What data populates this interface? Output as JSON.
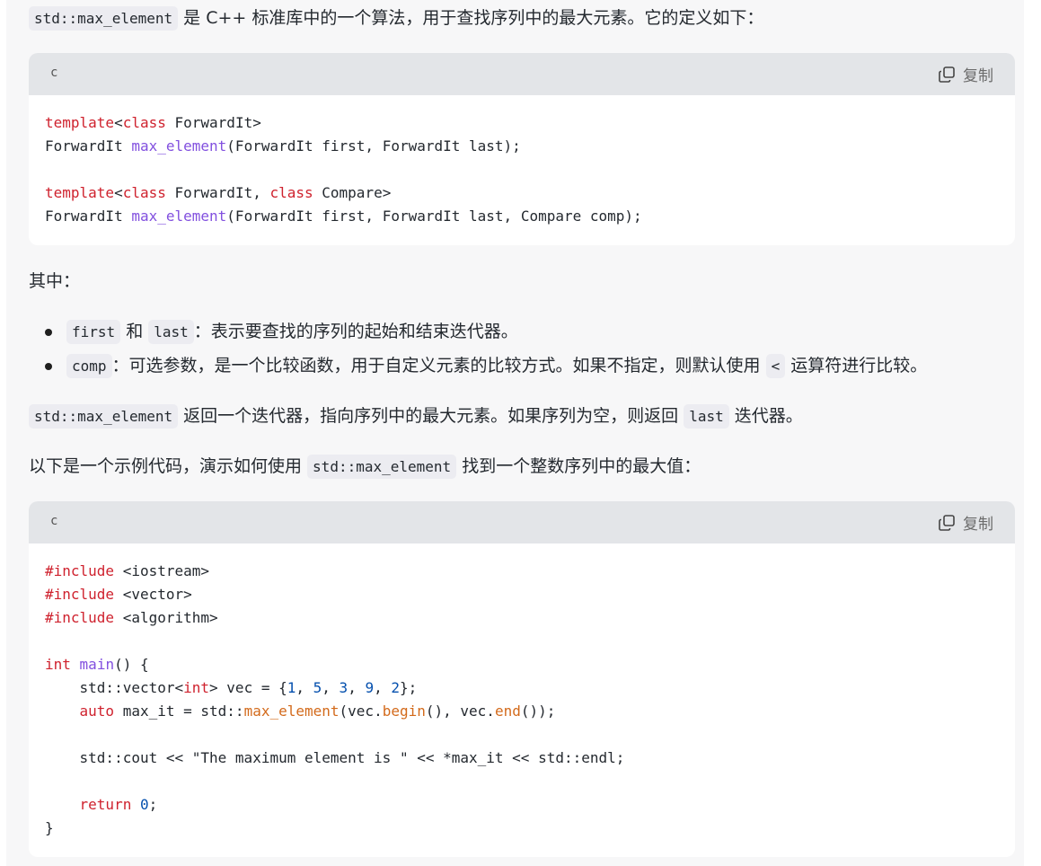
{
  "intro": {
    "code": "std::max_element",
    "text": " 是 C++ 标准库中的一个算法，用于查找序列中的最大元素。它的定义如下："
  },
  "code1": {
    "lang": "c",
    "copy_label": "复制",
    "lines": [
      [
        {
          "t": "template",
          "c": "kw"
        },
        {
          "t": "<"
        },
        {
          "t": "class",
          "c": "kw"
        },
        {
          "t": " ForwardIt>"
        }
      ],
      [
        {
          "t": "ForwardIt "
        },
        {
          "t": "max_element",
          "c": "fn"
        },
        {
          "t": "(ForwardIt first, ForwardIt last);"
        }
      ],
      [
        {
          "t": ""
        }
      ],
      [
        {
          "t": "template",
          "c": "kw"
        },
        {
          "t": "<"
        },
        {
          "t": "class",
          "c": "kw"
        },
        {
          "t": " ForwardIt, "
        },
        {
          "t": "class",
          "c": "kw"
        },
        {
          "t": " Compare>"
        }
      ],
      [
        {
          "t": "ForwardIt "
        },
        {
          "t": "max_element",
          "c": "fn"
        },
        {
          "t": "(ForwardIt first, ForwardIt last, Compare comp);"
        }
      ]
    ]
  },
  "where_label": "其中：",
  "bullets": [
    {
      "parts": [
        {
          "code": "first"
        },
        {
          "text": " 和 "
        },
        {
          "code": "last"
        },
        {
          "text": "：表示要查找的序列的起始和结束迭代器。"
        }
      ]
    },
    {
      "parts": [
        {
          "code": "comp"
        },
        {
          "text": "：可选参数，是一个比较函数，用于自定义元素的比较方式。如果不指定，则默认使用 "
        },
        {
          "code": "<"
        },
        {
          "text": " 运算符进行比较。"
        }
      ]
    }
  ],
  "returns": {
    "code1": "std::max_element",
    "text1": " 返回一个迭代器，指向序列中的最大元素。如果序列为空，则返回 ",
    "code2": "last",
    "text2": " 迭代器。"
  },
  "example_intro": {
    "text1": "以下是一个示例代码，演示如何使用 ",
    "code": "std::max_element",
    "text2": " 找到一个整数序列中的最大值："
  },
  "code2": {
    "lang": "c",
    "copy_label": "复制",
    "lines": [
      [
        {
          "t": "#include",
          "c": "kw"
        },
        {
          "t": " <iostream>"
        }
      ],
      [
        {
          "t": "#include",
          "c": "kw"
        },
        {
          "t": " <vector>"
        }
      ],
      [
        {
          "t": "#include",
          "c": "kw"
        },
        {
          "t": " <algorithm>"
        }
      ],
      [
        {
          "t": ""
        }
      ],
      [
        {
          "t": "int",
          "c": "kw"
        },
        {
          "t": " "
        },
        {
          "t": "main",
          "c": "fn"
        },
        {
          "t": "() {"
        }
      ],
      [
        {
          "t": "    std::vector<"
        },
        {
          "t": "int",
          "c": "kw"
        },
        {
          "t": "> vec = {"
        },
        {
          "t": "1",
          "c": "num"
        },
        {
          "t": ", "
        },
        {
          "t": "5",
          "c": "num"
        },
        {
          "t": ", "
        },
        {
          "t": "3",
          "c": "num"
        },
        {
          "t": ", "
        },
        {
          "t": "9",
          "c": "num"
        },
        {
          "t": ", "
        },
        {
          "t": "2",
          "c": "num"
        },
        {
          "t": "};"
        }
      ],
      [
        {
          "t": "    "
        },
        {
          "t": "auto",
          "c": "kw"
        },
        {
          "t": " max_it = std::"
        },
        {
          "t": "max_element",
          "c": "cl"
        },
        {
          "t": "(vec."
        },
        {
          "t": "begin",
          "c": "cl"
        },
        {
          "t": "(), vec."
        },
        {
          "t": "end",
          "c": "cl"
        },
        {
          "t": "());"
        }
      ],
      [
        {
          "t": ""
        }
      ],
      [
        {
          "t": "    std::cout << \"The maximum element is \" << *max_it << std::endl;"
        }
      ],
      [
        {
          "t": ""
        }
      ],
      [
        {
          "t": "    "
        },
        {
          "t": "return",
          "c": "kw"
        },
        {
          "t": " "
        },
        {
          "t": "0",
          "c": "num"
        },
        {
          "t": ";"
        }
      ],
      [
        {
          "t": "}"
        }
      ]
    ]
  }
}
